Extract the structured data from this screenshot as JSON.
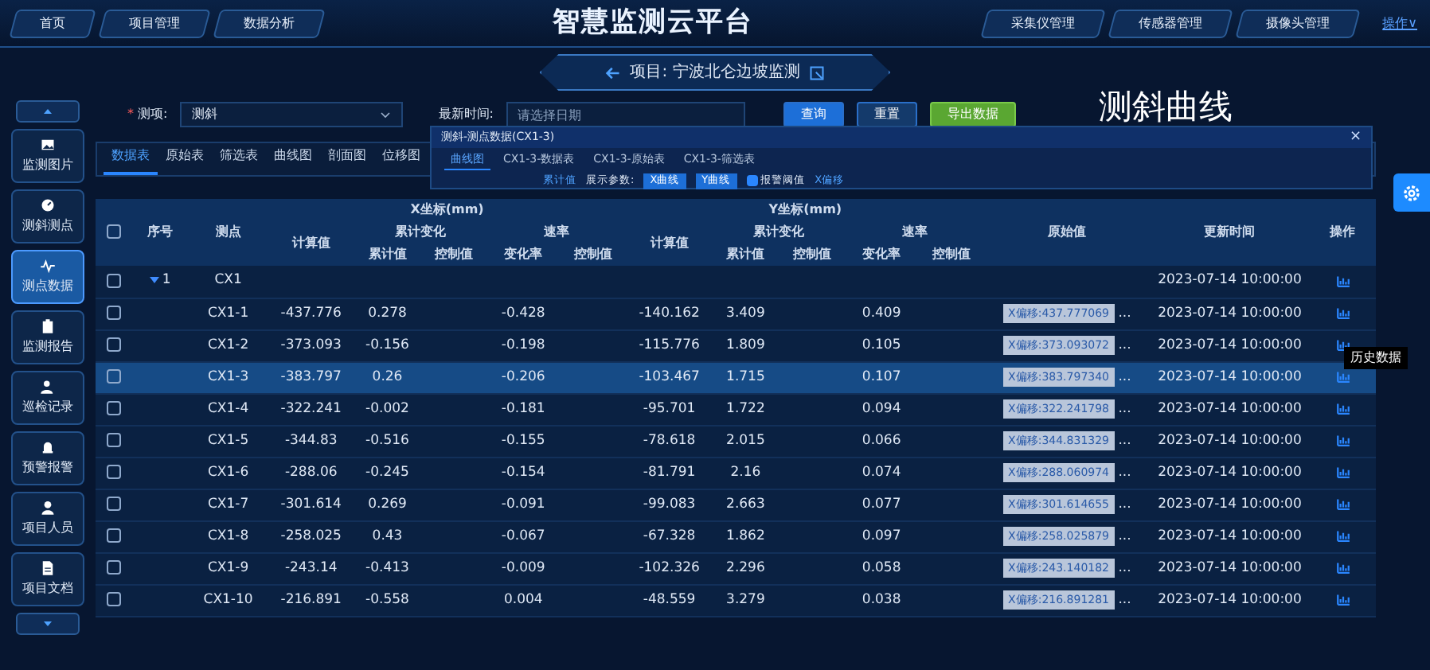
{
  "header": {
    "nav_left": [
      "首页",
      "项目管理",
      "数据分析"
    ],
    "title": "智慧监测云平台",
    "nav_right": [
      "采集仪管理",
      "传感器管理",
      "摄像头管理"
    ],
    "user_menu": "操作∨"
  },
  "banner": {
    "title": "项目: 宁波北仑边坡监测"
  },
  "caption": "测斜曲线",
  "sidebar": {
    "items": [
      {
        "label": "监测图片",
        "selected": false
      },
      {
        "label": "测斜测点",
        "selected": false
      },
      {
        "label": "测点数据",
        "selected": true
      },
      {
        "label": "监测报告",
        "selected": false
      },
      {
        "label": "巡检记录",
        "selected": false
      },
      {
        "label": "预警报警",
        "selected": false
      },
      {
        "label": "项目人员",
        "selected": false
      },
      {
        "label": "项目文档",
        "selected": false
      }
    ]
  },
  "filter": {
    "required_mark": "*",
    "item_label": "测项:",
    "item_value": "测斜",
    "time_label": "最新时间:",
    "time_placeholder": "请选择日期",
    "buttons": [
      {
        "label": "查询",
        "kind": "primary"
      },
      {
        "label": "重置",
        "kind": "plain"
      },
      {
        "label": "导出数据",
        "kind": "export"
      }
    ]
  },
  "tabs": [
    {
      "label": "数据表",
      "selected": true
    },
    {
      "label": "原始表",
      "selected": false
    },
    {
      "label": "筛选表",
      "selected": false
    },
    {
      "label": "曲线图",
      "selected": false
    },
    {
      "label": "剖面图",
      "selected": false
    },
    {
      "label": "位移图",
      "selected": false
    }
  ],
  "dialog": {
    "title": "测斜-测点数据(CX1-3)",
    "close": "×",
    "tabs": [
      {
        "label": "曲线图",
        "selected": true
      },
      {
        "label": "CX1-3-数据表",
        "selected": false
      },
      {
        "label": "CX1-3-原始表",
        "selected": false
      },
      {
        "label": "CX1-3-筛选表",
        "selected": false
      }
    ],
    "value_select": "累计值",
    "params_label": "展示参数:",
    "curve_buttons": [
      {
        "label": "X曲线",
        "on": true
      },
      {
        "label": "Y曲线",
        "on": true
      }
    ],
    "threshold": {
      "label": "报警阈值",
      "checked": true
    },
    "offset_select": "X偏移"
  },
  "table": {
    "header_checked": false,
    "lead_columns": [
      "序号",
      "测点"
    ],
    "axis_groups": [
      {
        "title": "X坐标(mm)",
        "calc": "计算值",
        "sub_groups": [
          {
            "title": "累计变化",
            "columns": [
              "累计值",
              "控制值"
            ]
          },
          {
            "title": "速率",
            "columns": [
              "变化率",
              "控制值"
            ]
          }
        ]
      },
      {
        "title": "Y坐标(mm)",
        "calc": "计算值",
        "sub_groups": [
          {
            "title": "累计变化",
            "columns": [
              "累计值",
              "控制值"
            ]
          },
          {
            "title": "速率",
            "columns": [
              "变化率",
              "控制值"
            ]
          }
        ]
      }
    ],
    "tail_columns": [
      "原始值",
      "更新时间",
      "操作"
    ],
    "rows": [
      {
        "kind": "group",
        "index": "1",
        "point": "CX1",
        "expanded": true,
        "checked": false,
        "selected": false,
        "time": "2023-07-14 10:00:00"
      },
      {
        "kind": "point",
        "point": "CX1-1",
        "checked": false,
        "selected": false,
        "x_calc": "-437.776",
        "x_cum": "0.278",
        "x_rate": "-0.428",
        "y_calc": "-140.162",
        "y_cum": "3.409",
        "y_rate": "0.409",
        "raw": "X偏移:437.777069",
        "raw_more": "...",
        "time": "2023-07-14 10:00:00"
      },
      {
        "kind": "point",
        "point": "CX1-2",
        "checked": false,
        "selected": false,
        "x_calc": "-373.093",
        "x_cum": "-0.156",
        "x_rate": "-0.198",
        "y_calc": "-115.776",
        "y_cum": "1.809",
        "y_rate": "0.105",
        "raw": "X偏移:373.093072",
        "raw_more": "...",
        "time": "2023-07-14 10:00:00"
      },
      {
        "kind": "point",
        "point": "CX1-3",
        "checked": false,
        "selected": true,
        "x_calc": "-383.797",
        "x_cum": "0.26",
        "x_rate": "-0.206",
        "y_calc": "-103.467",
        "y_cum": "1.715",
        "y_rate": "0.107",
        "raw": "X偏移:383.797340",
        "raw_more": "...",
        "time": "2023-07-14 10:00:00",
        "tooltip": "历史数据"
      },
      {
        "kind": "point",
        "point": "CX1-4",
        "checked": false,
        "selected": false,
        "x_calc": "-322.241",
        "x_cum": "-0.002",
        "x_rate": "-0.181",
        "y_calc": "-95.701",
        "y_cum": "1.722",
        "y_rate": "0.094",
        "raw": "X偏移:322.241798",
        "raw_more": "...",
        "time": "2023-07-14 10:00:00"
      },
      {
        "kind": "point",
        "point": "CX1-5",
        "checked": false,
        "selected": false,
        "x_calc": "-344.83",
        "x_cum": "-0.516",
        "x_rate": "-0.155",
        "y_calc": "-78.618",
        "y_cum": "2.015",
        "y_rate": "0.066",
        "raw": "X偏移:344.831329",
        "raw_more": "...",
        "time": "2023-07-14 10:00:00"
      },
      {
        "kind": "point",
        "point": "CX1-6",
        "checked": false,
        "selected": false,
        "x_calc": "-288.06",
        "x_cum": "-0.245",
        "x_rate": "-0.154",
        "y_calc": "-81.791",
        "y_cum": "2.16",
        "y_rate": "0.074",
        "raw": "X偏移:288.060974",
        "raw_more": "...",
        "time": "2023-07-14 10:00:00"
      },
      {
        "kind": "point",
        "point": "CX1-7",
        "checked": false,
        "selected": false,
        "x_calc": "-301.614",
        "x_cum": "0.269",
        "x_rate": "-0.091",
        "y_calc": "-99.083",
        "y_cum": "2.663",
        "y_rate": "0.077",
        "raw": "X偏移:301.614655",
        "raw_more": "...",
        "time": "2023-07-14 10:00:00"
      },
      {
        "kind": "point",
        "point": "CX1-8",
        "checked": false,
        "selected": false,
        "x_calc": "-258.025",
        "x_cum": "0.43",
        "x_rate": "-0.067",
        "y_calc": "-67.328",
        "y_cum": "1.862",
        "y_rate": "0.097",
        "raw": "X偏移:258.025879",
        "raw_more": "...",
        "time": "2023-07-14 10:00:00"
      },
      {
        "kind": "point",
        "point": "CX1-9",
        "checked": false,
        "selected": false,
        "x_calc": "-243.14",
        "x_cum": "-0.413",
        "x_rate": "-0.009",
        "y_calc": "-102.326",
        "y_cum": "2.296",
        "y_rate": "0.058",
        "raw": "X偏移:243.140182",
        "raw_more": "...",
        "time": "2023-07-14 10:00:00"
      },
      {
        "kind": "point",
        "point": "CX1-10",
        "checked": false,
        "selected": false,
        "x_calc": "-216.891",
        "x_cum": "-0.558",
        "x_rate": "0.004",
        "y_calc": "-48.559",
        "y_cum": "3.279",
        "y_rate": "0.038",
        "raw": "X偏移:216.891281",
        "raw_more": "...",
        "time": "2023-07-14 10:00:00"
      }
    ]
  }
}
